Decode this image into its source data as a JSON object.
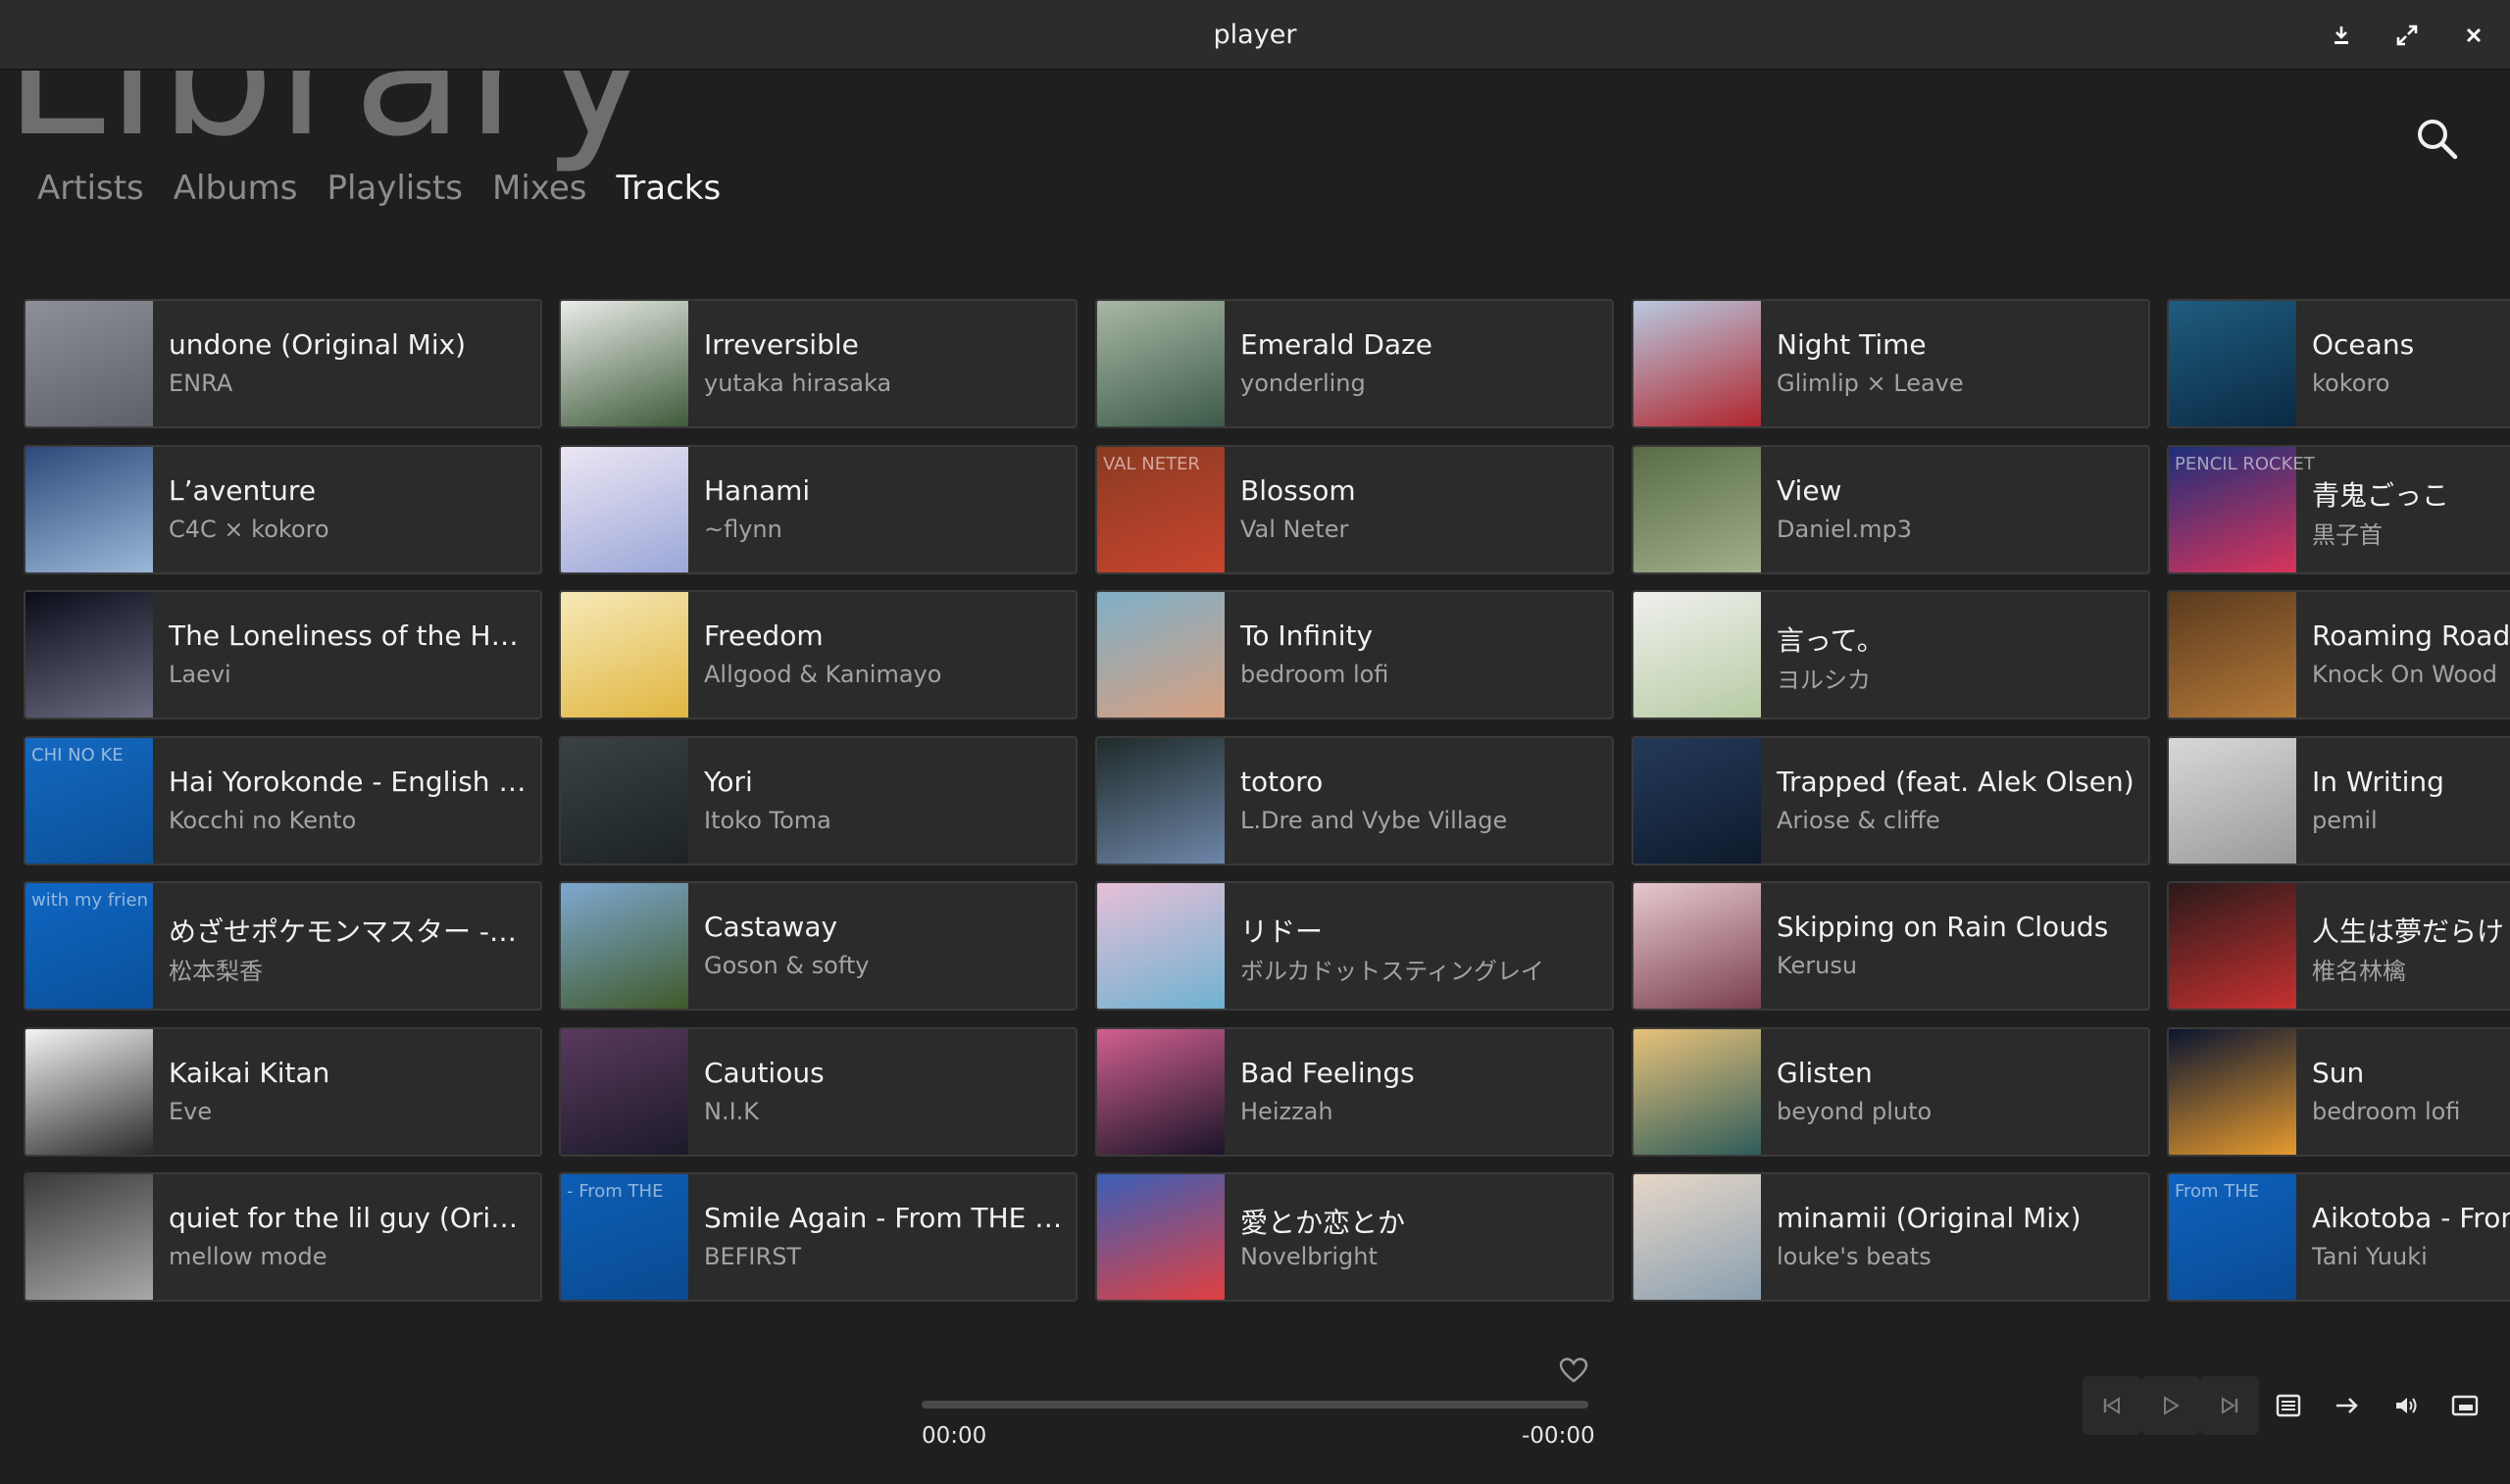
{
  "window": {
    "title": "player"
  },
  "header": {
    "big_title": "Library",
    "tabs": [
      "Artists",
      "Albums",
      "Playlists",
      "Mixes",
      "Tracks"
    ],
    "active_tab": "Tracks"
  },
  "tracks": [
    {
      "title": "undone (Original Mix)",
      "artist": "ENRA",
      "colors": [
        "#8d9096",
        "#5d6068"
      ]
    },
    {
      "title": "Irreversible",
      "artist": "yutaka hirasaka",
      "colors": [
        "#e9ece8",
        "#3f5a3a"
      ]
    },
    {
      "title": "Emerald Daze",
      "artist": "yonderling",
      "colors": [
        "#a9b8a4",
        "#3c5a4a"
      ]
    },
    {
      "title": "Night Time",
      "artist": "Glimlip × Leave",
      "colors": [
        "#b8c9e0",
        "#b0252d"
      ]
    },
    {
      "title": "Oceans",
      "artist": "kokoro",
      "colors": [
        "#1f5c7e",
        "#0a2a44"
      ]
    },
    {
      "title": "L’aventure",
      "artist": "C4C × kokoro",
      "colors": [
        "#2c4a7a",
        "#9bb7d8"
      ]
    },
    {
      "title": "Hanami",
      "artist": "~flynn",
      "colors": [
        "#ece6f4",
        "#9ba7d8"
      ]
    },
    {
      "title": "Blossom",
      "artist": "Val Neter",
      "colors": [
        "#8a3a22",
        "#c9452e"
      ],
      "text": "VAL NETER"
    },
    {
      "title": "View",
      "artist": "Daniel.mp3",
      "colors": [
        "#5a6b48",
        "#9fb08a"
      ]
    },
    {
      "title": "青鬼ごっこ",
      "artist": "黒子首",
      "colors": [
        "#1c2f7a",
        "#d9345b"
      ],
      "text": "PENCIL ROCKET"
    },
    {
      "title": "The Loneliness of the Hedgehog",
      "artist": "Laevi",
      "colors": [
        "#0b0c1a",
        "#6b6c80"
      ]
    },
    {
      "title": "Freedom",
      "artist": "Allgood & Kanimayo",
      "colors": [
        "#f6e9b8",
        "#e0b640"
      ]
    },
    {
      "title": "To Infinity",
      "artist": "bedroom lofi",
      "colors": [
        "#7fb0c9",
        "#d79f7e"
      ]
    },
    {
      "title": "言って。",
      "artist": "ヨルシカ",
      "colors": [
        "#f0f0ee",
        "#b6cba2"
      ]
    },
    {
      "title": "Roaming Road",
      "artist": "Knock On Wood",
      "colors": [
        "#5a3a1e",
        "#b47938"
      ]
    },
    {
      "title": "Hai Yorokonde - English ver",
      "artist": "Kocchi no Kento",
      "colors": [
        "#1469c2",
        "#0b4f96"
      ],
      "text": "CHI NO KE"
    },
    {
      "title": "Yori",
      "artist": "Itoko Toma",
      "colors": [
        "#3a4246",
        "#1c2226"
      ]
    },
    {
      "title": "totoro",
      "artist": "L.Dre and Vybe Village",
      "colors": [
        "#1f2b2a",
        "#6d86a8"
      ]
    },
    {
      "title": "Trapped (feat. Alek Olsen)",
      "artist": "Ariose & cliffe",
      "colors": [
        "#243a5a",
        "#0e1a2c"
      ]
    },
    {
      "title": "In Writing",
      "artist": "pemil",
      "colors": [
        "#d8d8d8",
        "#9a9a9a"
      ]
    },
    {
      "title": "めざせポケモンマスター -with my friends-",
      "artist": "松本梨香",
      "colors": [
        "#0f67c4",
        "#0a4f98"
      ],
      "text": "with my frien"
    },
    {
      "title": "Castaway",
      "artist": "Goson & softy",
      "colors": [
        "#7fa8d1",
        "#3f5a2a"
      ]
    },
    {
      "title": "リドー",
      "artist": "ボルカドットスティングレイ",
      "colors": [
        "#e6bfd8",
        "#6fb2d0"
      ]
    },
    {
      "title": "Skipping on Rain Clouds",
      "artist": "Kerusu",
      "colors": [
        "#e7c9cf",
        "#7a4050"
      ]
    },
    {
      "title": "人生は夢だらけ",
      "artist": "椎名林檎",
      "colors": [
        "#2a1a1a",
        "#c73030"
      ]
    },
    {
      "title": "Kaikai Kitan",
      "artist": "Eve",
      "colors": [
        "#f4f4f4",
        "#2a2a2a"
      ]
    },
    {
      "title": "Cautious",
      "artist": "N.I.K",
      "colors": [
        "#5a3a5e",
        "#1c1a2a"
      ]
    },
    {
      "title": "Bad Feelings",
      "artist": "Heizzah",
      "colors": [
        "#d0608f",
        "#1a1428"
      ]
    },
    {
      "title": "Glisten",
      "artist": "beyond pluto",
      "colors": [
        "#e8c27a",
        "#2e5c5a"
      ]
    },
    {
      "title": "Sun",
      "artist": "bedroom lofi",
      "colors": [
        "#0a1530",
        "#e69a2e"
      ]
    },
    {
      "title": "quiet for the lil guy (Original Mix)",
      "artist": "mellow mode",
      "colors": [
        "#3a3a3a",
        "#a8a8a8"
      ]
    },
    {
      "title": "Smile Again - From THE FIRST TAKE",
      "artist": "BEFIRST",
      "colors": [
        "#0d5eb6",
        "#0a4a90"
      ],
      "text": "- From THE"
    },
    {
      "title": "愛とか恋とか",
      "artist": "Novelbright",
      "colors": [
        "#3a5fb8",
        "#e04040"
      ]
    },
    {
      "title": "minamii (Original Mix)",
      "artist": "louke's beats",
      "colors": [
        "#e6d7c8",
        "#8a9fb0"
      ]
    },
    {
      "title": "Aikotoba - From THE FIRST TAKE",
      "artist": "Tani Yuuki",
      "colors": [
        "#0e62bf",
        "#0a4a92"
      ],
      "text": "From THE"
    }
  ],
  "player": {
    "time_elapsed": "00:00",
    "time_remaining": "-00:00",
    "progress": 0
  }
}
